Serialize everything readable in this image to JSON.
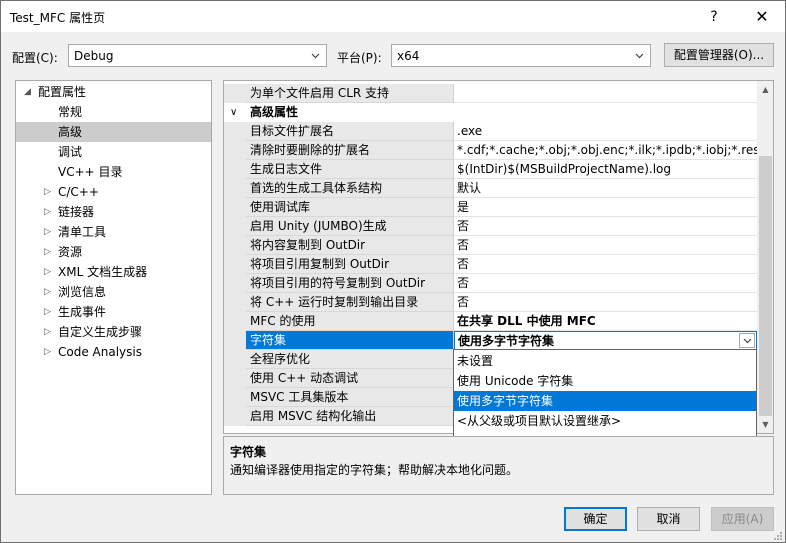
{
  "window": {
    "title": "Test_MFC 属性页",
    "help": "?",
    "close": "✕"
  },
  "toolbar": {
    "config_label": "配置(C):",
    "config_value": "Debug",
    "platform_label": "平台(P):",
    "platform_value": "x64",
    "manager_button": "配置管理器(O)..."
  },
  "tree": {
    "root": "配置属性",
    "items": [
      {
        "label": "常规"
      },
      {
        "label": "高级"
      },
      {
        "label": "调试"
      },
      {
        "label": "VC++ 目录"
      },
      {
        "label": "C/C++"
      },
      {
        "label": "链接器"
      },
      {
        "label": "清单工具"
      },
      {
        "label": "资源"
      },
      {
        "label": "XML 文档生成器"
      },
      {
        "label": "浏览信息"
      },
      {
        "label": "生成事件"
      },
      {
        "label": "自定义生成步骤"
      },
      {
        "label": "Code Analysis"
      }
    ]
  },
  "grid": {
    "top_row": {
      "name": "为单个文件启用 CLR 支持",
      "value": ""
    },
    "category": "高级属性",
    "rows": [
      {
        "name": "目标文件扩展名",
        "value": ".exe"
      },
      {
        "name": "清除时要删除的扩展名",
        "value": "*.cdf;*.cache;*.obj;*.obj.enc;*.ilk;*.ipdb;*.iobj;*.resources"
      },
      {
        "name": "生成日志文件",
        "value": "$(IntDir)$(MSBuildProjectName).log"
      },
      {
        "name": "首选的生成工具体系结构",
        "value": "默认"
      },
      {
        "name": "使用调试库",
        "value": "是"
      },
      {
        "name": "启用 Unity (JUMBO)生成",
        "value": "否"
      },
      {
        "name": "将内容复制到 OutDir",
        "value": "否"
      },
      {
        "name": "将项目引用复制到 OutDir",
        "value": "否"
      },
      {
        "name": "将项目引用的符号复制到 OutDir",
        "value": "否"
      },
      {
        "name": "将 C++ 运行时复制到输出目录",
        "value": "否"
      },
      {
        "name": "MFC 的使用",
        "value": "在共享 DLL 中使用 MFC"
      },
      {
        "name": "字符集",
        "value": "使用多字节字符集"
      },
      {
        "name": "全程序优化",
        "value": ""
      },
      {
        "name": "使用 C++ 动态调试",
        "value": ""
      },
      {
        "name": "MSVC 工具集版本",
        "value": ""
      },
      {
        "name": "启用 MSVC 结构化输出",
        "value": ""
      }
    ]
  },
  "dropdown": {
    "options": [
      "未设置",
      "使用 Unicode 字符集",
      "使用多字节字符集",
      "<从父级或项目默认设置继承>"
    ]
  },
  "description": {
    "title": "字符集",
    "text": "通知编译器使用指定的字符集；帮助解决本地化问题。"
  },
  "buttons": {
    "ok": "确定",
    "cancel": "取消",
    "apply": "应用(A)"
  }
}
